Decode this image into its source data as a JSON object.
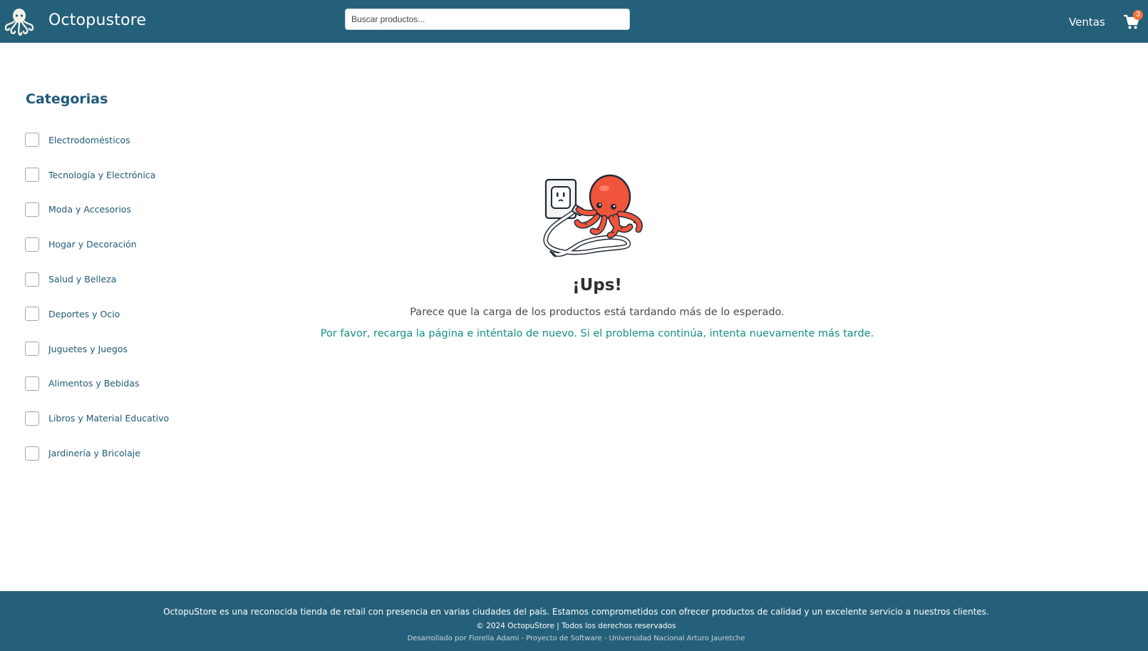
{
  "header": {
    "brand": "Octopustore",
    "search_placeholder": "Buscar productos...",
    "nav_sales": "Ventas",
    "cart_count": "3",
    "logo_icon": "octopus-logo-icon",
    "cart_icon": "shopping-cart-icon"
  },
  "sidebar": {
    "title": "Categorias",
    "items": [
      {
        "label": "Electrodomésticos"
      },
      {
        "label": "Tecnología y Electrónica"
      },
      {
        "label": "Moda y Accesorios"
      },
      {
        "label": "Hogar y Decoración"
      },
      {
        "label": "Salud y Belleza"
      },
      {
        "label": "Deportes y Ocio"
      },
      {
        "label": "Juguetes y Juegos"
      },
      {
        "label": "Alimentos y Bebidas"
      },
      {
        "label": "Libros y Material Educativo"
      },
      {
        "label": "Jardinería y Bricolaje"
      }
    ]
  },
  "error": {
    "illustration": "octopus-unplugging-outlet-illustration",
    "title": "¡Ups!",
    "message": "Parece que la carga de los productos está tardando más de lo esperado.",
    "hint": "Por favor, recarga la página e inténtalo de nuevo. Si el problema continúa, intenta nuevamente más tarde."
  },
  "footer": {
    "description": "OctopuStore es una reconocida tienda de retail con presencia en varias ciudades del país. Estamos comprometidos con ofrecer productos de calidad y un excelente servicio a nuestros clientes.",
    "copyright": "© 2024 OctopuStore | Todos los derechos reservados",
    "developer": "Desarrollado por Fiorella Adami - Proyecto de Software - Universidad Nacional Arturo Jauretche"
  },
  "colors": {
    "header_bg": "#25607b",
    "accent_text": "#1f5a78",
    "hint_text": "#138f85",
    "badge": "#f2733c",
    "octopus": "#f0553c"
  }
}
